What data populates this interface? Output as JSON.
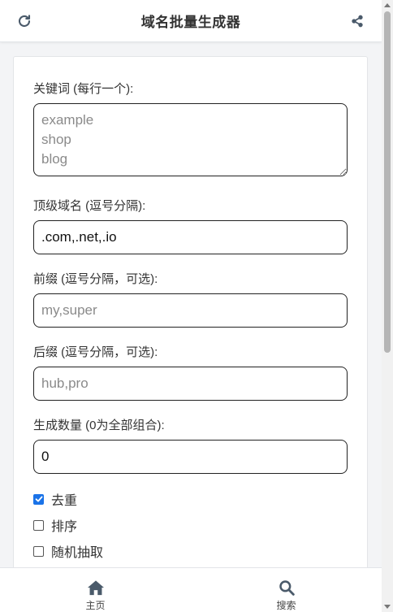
{
  "header": {
    "title": "域名批量生成器",
    "refresh_icon": "refresh-icon",
    "share_icon": "share-icon"
  },
  "form": {
    "keywords": {
      "label": "关键词 (每行一个):",
      "placeholder": "example\nshop\nblog",
      "value": ""
    },
    "tlds": {
      "label": "顶级域名 (逗号分隔):",
      "placeholder": "",
      "value": ".com,.net,.io"
    },
    "prefix": {
      "label": "前缀 (逗号分隔，可选):",
      "placeholder": "my,super",
      "value": ""
    },
    "suffix": {
      "label": "后缀 (逗号分隔，可选):",
      "placeholder": "hub,pro",
      "value": ""
    },
    "count": {
      "label": "生成数量 (0为全部组合):",
      "placeholder": "",
      "value": "0"
    },
    "options": [
      {
        "label": "去重",
        "checked": true
      },
      {
        "label": "排序",
        "checked": false
      },
      {
        "label": "随机抽取",
        "checked": false
      }
    ]
  },
  "tabbar": {
    "home": {
      "label": "主页",
      "icon": "home-icon"
    },
    "search": {
      "label": "搜索",
      "icon": "search-icon"
    }
  },
  "colors": {
    "accent": "#1a73e8",
    "icon": "#4a5a6a",
    "background": "#f3f4f6"
  }
}
